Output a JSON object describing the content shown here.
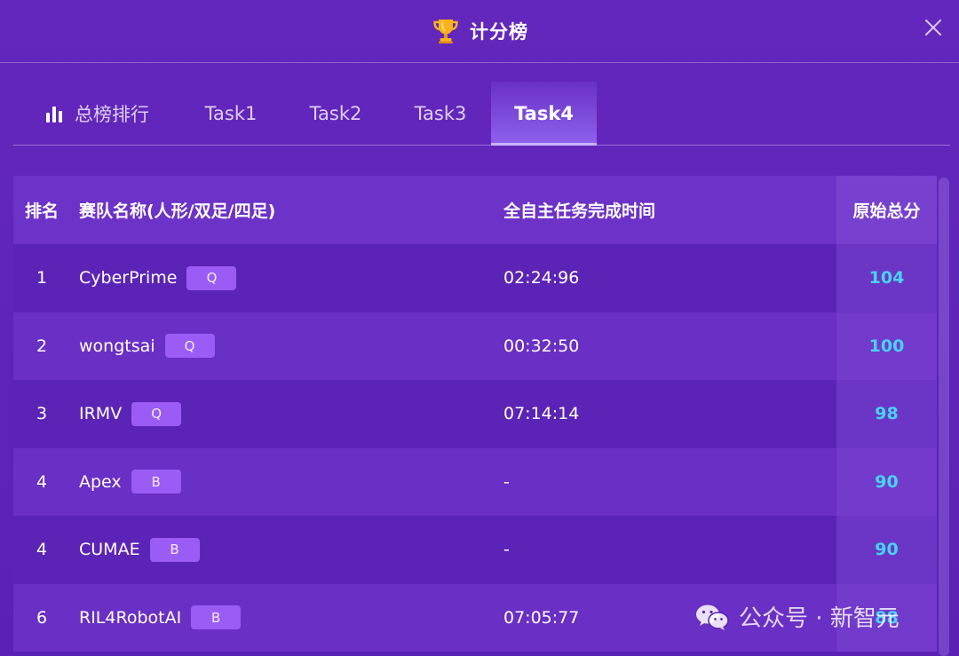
{
  "header": {
    "title": "计分榜",
    "trophy_icon": "trophy-icon",
    "close_icon": "close-icon"
  },
  "tabs": [
    {
      "label": "总榜排行",
      "icon": "bar-chart-icon",
      "active": false
    },
    {
      "label": "Task1",
      "active": false
    },
    {
      "label": "Task2",
      "active": false
    },
    {
      "label": "Task3",
      "active": false
    },
    {
      "label": "Task4",
      "active": true
    }
  ],
  "table": {
    "columns": [
      "排名",
      "赛队名称(人形/双足/四足)",
      "全自主任务完成时间",
      "原始总分"
    ],
    "rows": [
      {
        "rank": "1",
        "team": "CyberPrime",
        "type": "Q",
        "time": "02:24:96",
        "score": "104"
      },
      {
        "rank": "2",
        "team": "wongtsai",
        "type": "Q",
        "time": "00:32:50",
        "score": "100"
      },
      {
        "rank": "3",
        "team": "IRMV",
        "type": "Q",
        "time": "07:14:14",
        "score": "98"
      },
      {
        "rank": "4",
        "team": "Apex",
        "type": "B",
        "time": "-",
        "score": "90"
      },
      {
        "rank": "4",
        "team": "CUMAE",
        "type": "B",
        "time": "-",
        "score": "90"
      },
      {
        "rank": "6",
        "team": "RIL4RobotAI",
        "type": "B",
        "time": "07:05:77",
        "score": "88"
      }
    ]
  },
  "watermark": {
    "text": "公众号 · 新智元",
    "icon": "wechat-icon"
  },
  "colors": {
    "background": "#5b23b8",
    "tab_active": "#8e62ef",
    "badge": "#9a5cf5",
    "score": "#48d4f5"
  }
}
